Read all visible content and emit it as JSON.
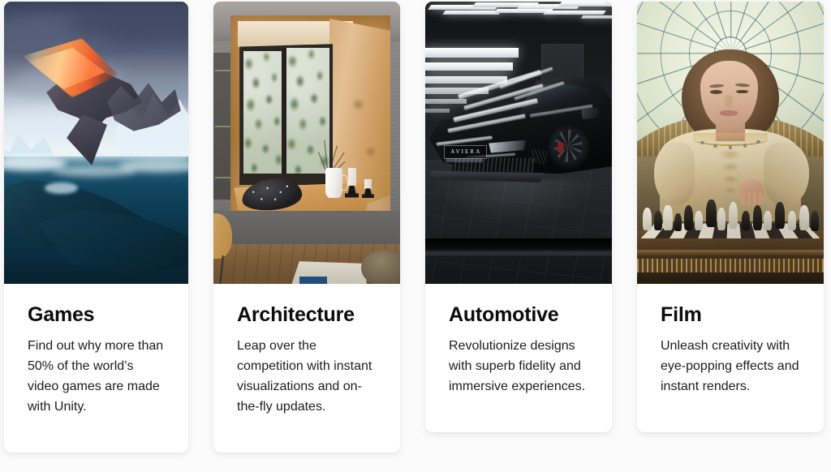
{
  "page": {
    "background_color": "#fbfbfb",
    "layout": "four-column card grid"
  },
  "cards": [
    {
      "id": "games",
      "title": "Games",
      "description": "Find out why more than 50% of the world’s video games are made with Unity.",
      "image_alt": "Stylized game artwork of a large sea creature breaching icy water with a glowing orange spike under a stormy sky",
      "image_palette": {
        "sky": "#49536c",
        "ice": "#e4f1f7",
        "water": "#0c3b52",
        "accent": "#f05f2d"
      }
    },
    {
      "id": "architecture",
      "title": "Architecture",
      "description": "Leap over the competition with instant visualizations and on-the-fly updates.",
      "image_alt": "Architectural visualization of a wooden bay window nook in a concrete wall, with ivy outside, a white pitcher, candles and a dark cushion on the sill",
      "image_palette": {
        "wall": "#7b7a79",
        "wood": "#c59a63",
        "glass": "#c8d2c0",
        "floor": "#7b5c3a"
      }
    },
    {
      "id": "automotive",
      "title": "Automotive",
      "description": "Revolutionize designs with superb fidelity and immersive experiences.",
      "image_alt": "Black sports car rendered in a dark studio with horizontal white LED light strips reflecting off the bodywork",
      "badge_text": "AVIERA",
      "image_palette": {
        "background": "#1c1d20",
        "light": "#ffffff",
        "body": "#0a0b0d",
        "caliper": "#8b1f24"
      }
    },
    {
      "id": "film",
      "title": "Film",
      "description": "Unleash creativity with eye-popping effects and instant renders.",
      "image_alt": "Film still of a woman in a cream and gold embroidered blouse playing chess beneath a pale green radial glass dome",
      "image_palette": {
        "dome": "#e6ecd9",
        "spokes": "#2c5c6c",
        "garment": "#e3d2ad",
        "table": "#553f25"
      }
    }
  ]
}
